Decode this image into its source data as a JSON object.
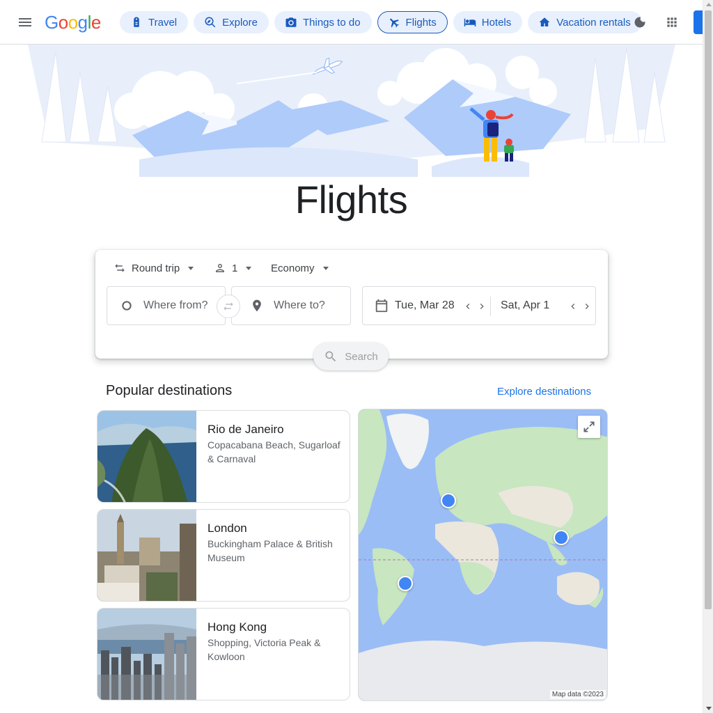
{
  "header": {
    "logo": "Google",
    "chips": [
      {
        "label": "Travel",
        "icon": "travel-tag-icon"
      },
      {
        "label": "Explore",
        "icon": "explore-icon"
      },
      {
        "label": "Things to do",
        "icon": "camera-icon"
      },
      {
        "label": "Flights",
        "icon": "airplane-icon",
        "active": true
      },
      {
        "label": "Hotels",
        "icon": "bed-icon"
      },
      {
        "label": "Vacation rentals",
        "icon": "house-icon"
      }
    ]
  },
  "page_title": "Flights",
  "search": {
    "trip_type": "Round trip",
    "passengers": "1",
    "cabin_class": "Economy",
    "from_placeholder": "Where from?",
    "to_placeholder": "Where to?",
    "depart_date": "Tue, Mar 28",
    "return_date": "Sat, Apr 1",
    "search_label": "Search"
  },
  "popular": {
    "title": "Popular destinations",
    "explore_link": "Explore destinations",
    "destinations": [
      {
        "name": "Rio de Janeiro",
        "desc": "Copacabana Beach, Sugarloaf & Carnaval"
      },
      {
        "name": "London",
        "desc": "Buckingham Palace & British Museum"
      },
      {
        "name": "Hong Kong",
        "desc": "Shopping, Victoria Peak & Kowloon"
      }
    ]
  },
  "map": {
    "credit": "Map data ©2023"
  },
  "colors": {
    "accent": "#1a73e8",
    "chip_bg": "#e8f0fe",
    "chip_text": "#185abc",
    "map_water": "#9bbdf5",
    "map_land": "#c8e6c0"
  }
}
